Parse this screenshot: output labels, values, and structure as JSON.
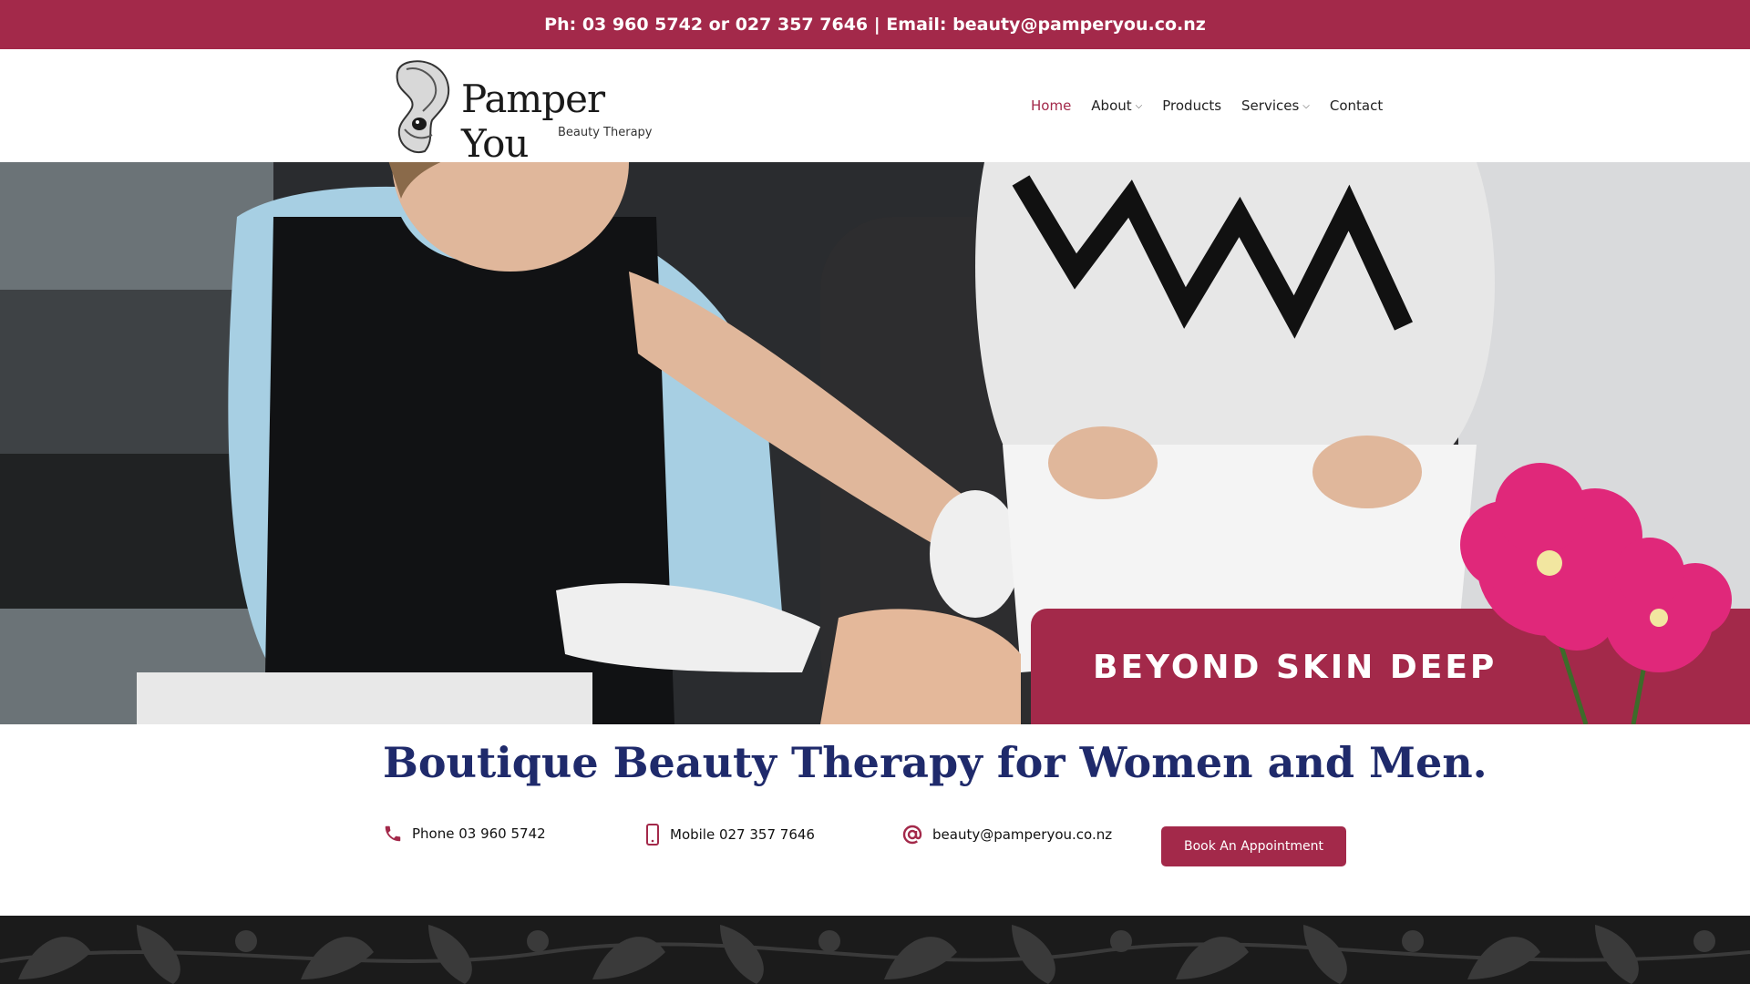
{
  "topbar": {
    "text": "Ph: 03 960 5742 or 027 357 7646 | Email: beauty@pamperyou.co.nz"
  },
  "logo": {
    "title": "Pamper You",
    "subtitle": "Beauty Therapy"
  },
  "nav": {
    "items": [
      {
        "label": "Home",
        "active": true,
        "dropdown": false
      },
      {
        "label": "About",
        "active": false,
        "dropdown": true
      },
      {
        "label": "Products",
        "active": false,
        "dropdown": false
      },
      {
        "label": "Services",
        "active": false,
        "dropdown": true
      },
      {
        "label": "Contact",
        "active": false,
        "dropdown": false
      }
    ]
  },
  "hero": {
    "banner_text": "BEYOND SKIN DEEP"
  },
  "tagline": "Boutique Beauty Therapy for Women and Men.",
  "contacts": {
    "phone": "Phone 03 960 5742",
    "mobile": "Mobile 027 357 7646",
    "email": "beauty@pamperyou.co.nz"
  },
  "book_button": "Book An Appointment",
  "colors": {
    "brand": "#a3294a",
    "tagline": "#1f2a6b",
    "flower": "#e0287a"
  }
}
